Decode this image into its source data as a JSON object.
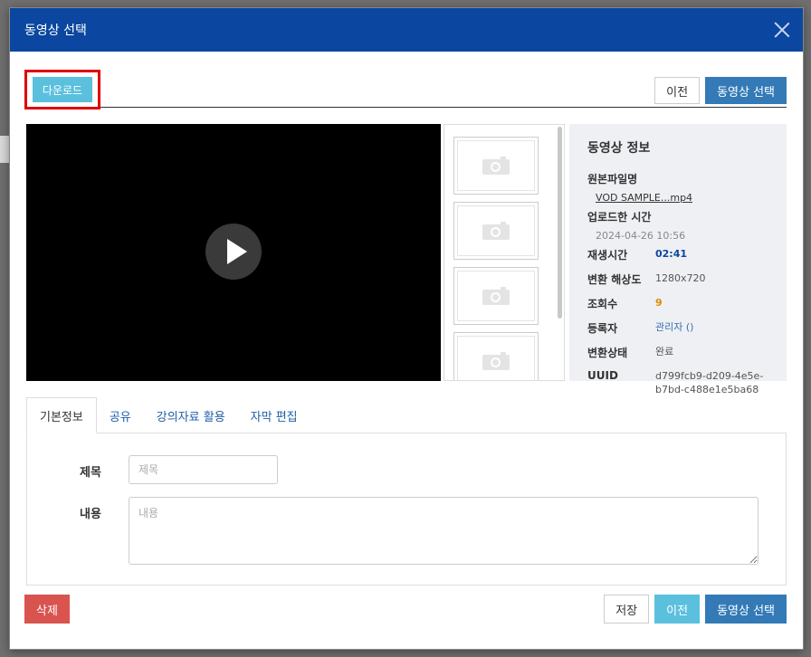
{
  "modal": {
    "title": "동영상 선택"
  },
  "toolbar": {
    "download_label": "다운로드",
    "prev_label": "이전",
    "select_label": "동영상 선택"
  },
  "video_info": {
    "title": "동영상 정보",
    "original_filename_label": "원본파일명",
    "original_filename": "VOD SAMPLE...mp4",
    "upload_time_label": "업로드한 시간",
    "upload_time": "2024-04-26 10:56",
    "fields": [
      {
        "label": "재생시간",
        "value": "02:41"
      },
      {
        "label": "변환 해상도",
        "value": "1280x720"
      },
      {
        "label": "조회수",
        "value": "9"
      },
      {
        "label": "등록자",
        "value": "관리자 ()"
      },
      {
        "label": "변환상태",
        "value": "완료"
      },
      {
        "label": "UUID",
        "value": "d799fcb9-d209-4e5e-b7bd-c488e1e5ba68"
      }
    ]
  },
  "tabs": [
    {
      "label": "기본정보",
      "active": true
    },
    {
      "label": "공유"
    },
    {
      "label": "강의자료 활용"
    },
    {
      "label": "자막 편집"
    }
  ],
  "form": {
    "title_label": "제목",
    "title_placeholder": "제목",
    "content_label": "내용",
    "content_placeholder": "내용"
  },
  "footer": {
    "delete_label": "삭제",
    "save_label": "저장",
    "prev_label": "이전",
    "select_label": "동영상 선택"
  },
  "colors": {
    "header": "#0b47a0",
    "download": "#5bc0de",
    "primary": "#337ab7",
    "danger": "#d9534f",
    "highlight": "#e00000"
  }
}
